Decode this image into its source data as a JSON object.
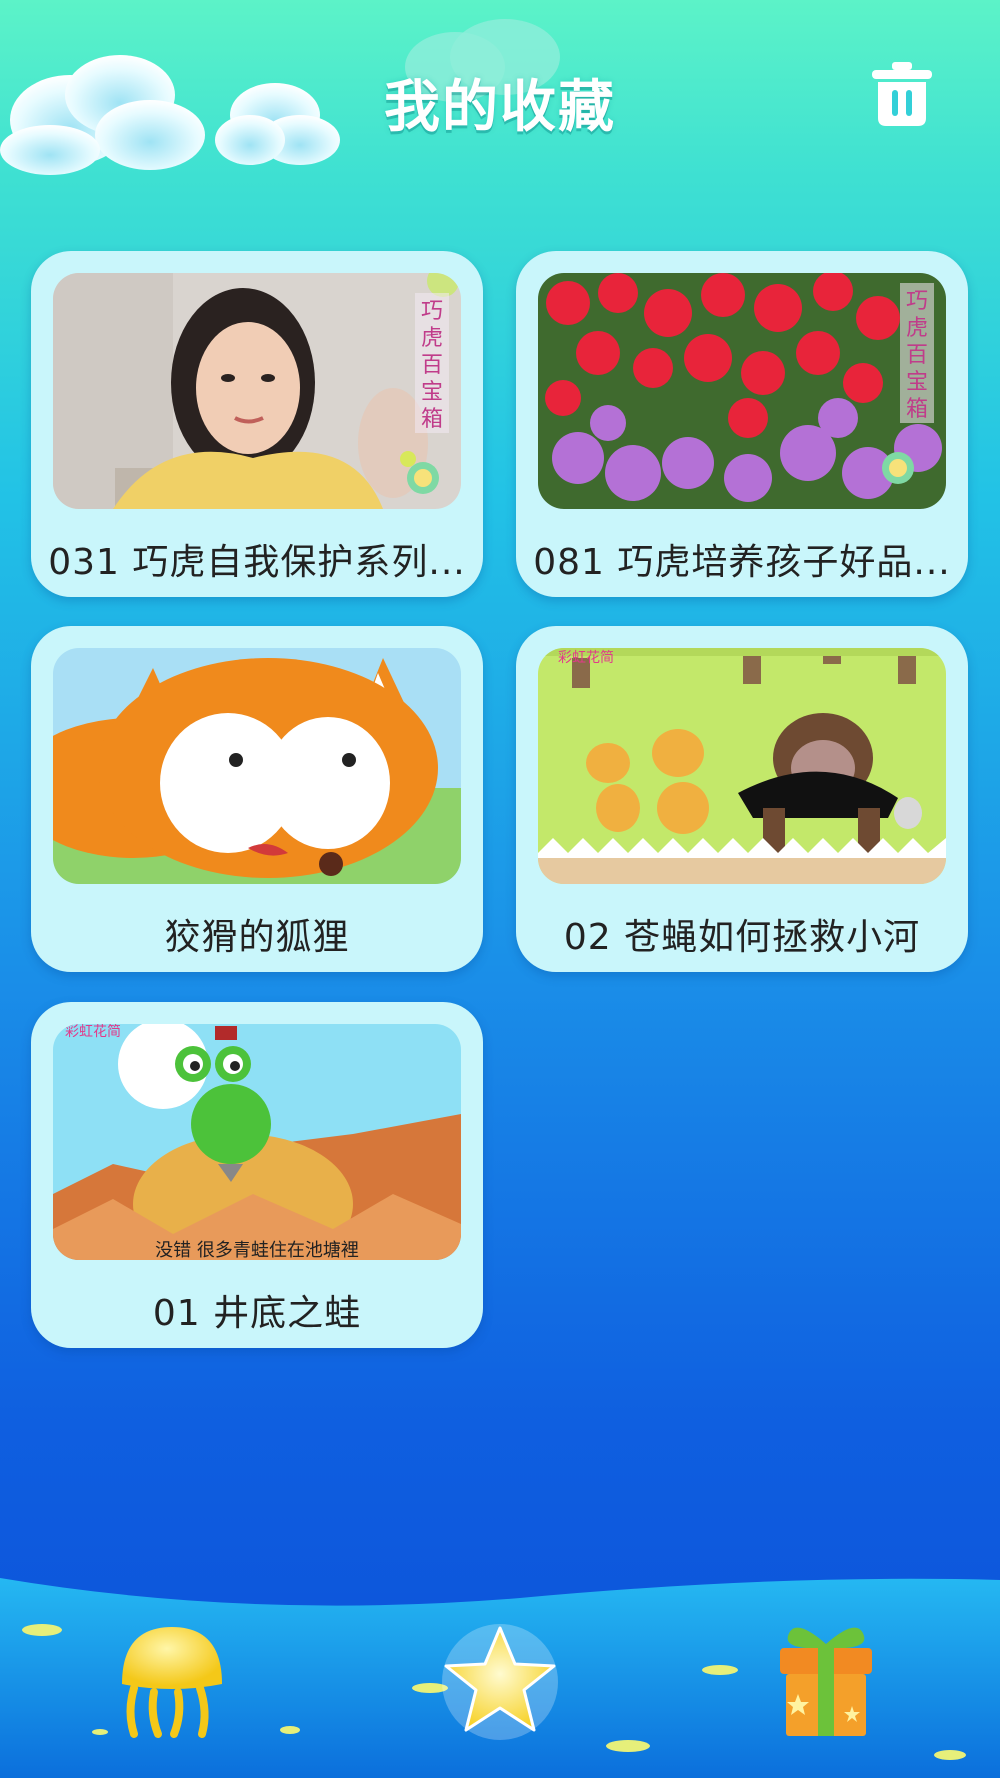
{
  "header": {
    "title": "我的收藏",
    "delete_icon": "trash-icon"
  },
  "favorites": [
    {
      "title": "031 巧虎自我保护系列...",
      "thumb_overlay": "巧虎百宝箱"
    },
    {
      "title": "081 巧虎培养孩子好品...",
      "thumb_overlay": "巧虎百宝箱"
    },
    {
      "title": "狡猾的狐狸"
    },
    {
      "title": "02 苍蝇如何拯救小河",
      "thumb_logo": "彩虹花简"
    },
    {
      "title": "01 井底之蛙",
      "thumb_logo": "彩虹花简",
      "thumb_caption": "没错 很多青蛙住在池塘裡"
    }
  ],
  "bottom_nav": [
    {
      "icon": "jellyfish-icon"
    },
    {
      "icon": "star-icon",
      "selected": true
    },
    {
      "icon": "gift-icon"
    }
  ],
  "colors": {
    "card_bg": "#c9f6fb",
    "title_text": "#ffffff"
  }
}
